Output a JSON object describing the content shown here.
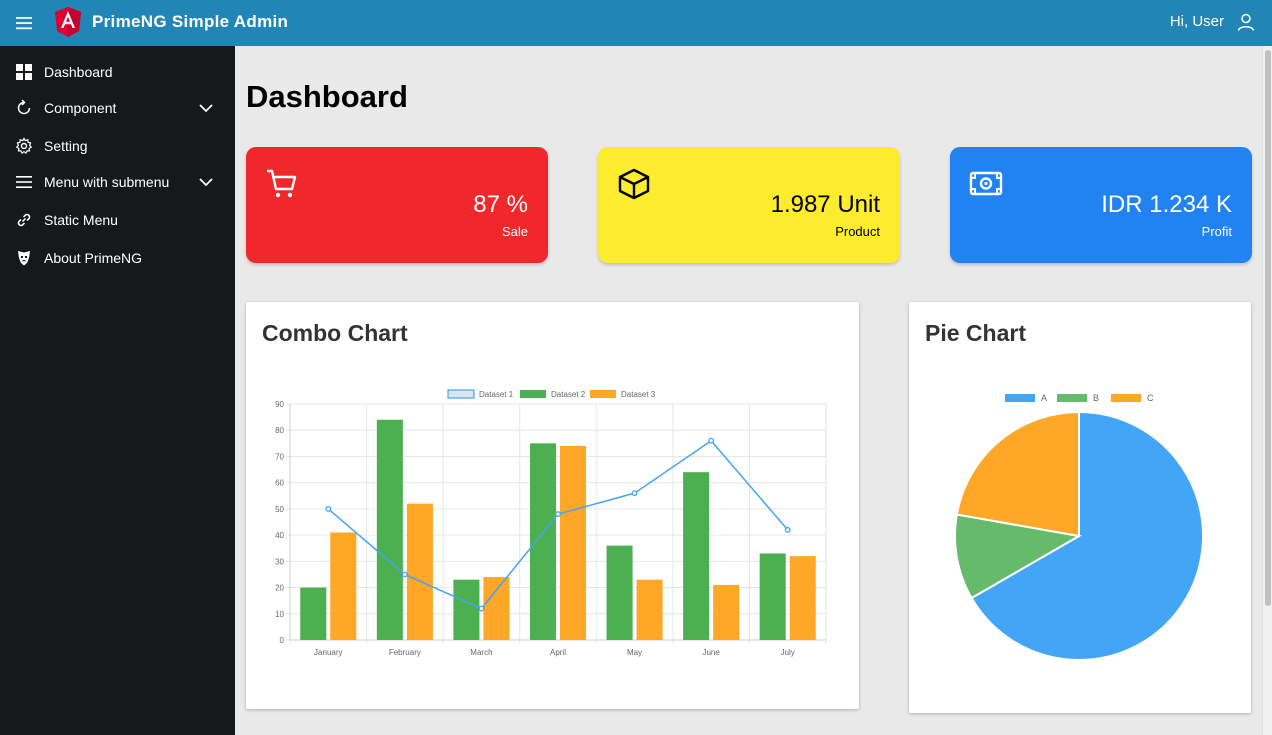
{
  "topbar": {
    "title": "PrimeNG Simple Admin",
    "greeting": "Hi, User",
    "logo_icon": "angular-logo-icon",
    "color": "#2185b5"
  },
  "sidebar": {
    "items": [
      {
        "label": "Dashboard",
        "icon": "grid-icon",
        "has_submenu": false
      },
      {
        "label": "Component",
        "icon": "refresh-icon",
        "has_submenu": true
      },
      {
        "label": "Setting",
        "icon": "gear-icon",
        "has_submenu": false
      },
      {
        "label": "Menu with submenu",
        "icon": "bars-icon",
        "has_submenu": true
      },
      {
        "label": "Static Menu",
        "icon": "link-icon",
        "has_submenu": false
      },
      {
        "label": "About PrimeNG",
        "icon": "prime-logo-icon",
        "has_submenu": false
      }
    ]
  },
  "page": {
    "title": "Dashboard"
  },
  "cards": [
    {
      "value": "87 %",
      "label": "Sale",
      "icon": "cart-icon",
      "color": "#f0282c",
      "text_color": "#ffffff"
    },
    {
      "value": "1.987 Unit",
      "label": "Product",
      "icon": "box-icon",
      "color": "#fdeb2d",
      "text_color": "#000000"
    },
    {
      "value": "IDR 1.234 K",
      "label": "Profit",
      "icon": "money-icon",
      "color": "#2182f2",
      "text_color": "#ffffff"
    }
  ],
  "combo": {
    "title": "Combo Chart"
  },
  "pie": {
    "title": "Pie Chart"
  },
  "chart_data": [
    {
      "type": "bar",
      "subtype": "combo (line + bar)",
      "categories": [
        "January",
        "February",
        "March",
        "April",
        "May",
        "June",
        "July"
      ],
      "series": [
        {
          "name": "Dataset 1",
          "type": "line",
          "color": "#42a5f5",
          "values": [
            50,
            25,
            12,
            48,
            56,
            76,
            42
          ]
        },
        {
          "name": "Dataset 2",
          "type": "bar",
          "color": "#4caf50",
          "values": [
            20,
            84,
            23,
            75,
            36,
            64,
            33
          ]
        },
        {
          "name": "Dataset 3",
          "type": "bar",
          "color": "#ffa726",
          "values": [
            41,
            52,
            24,
            74,
            23,
            21,
            32
          ]
        }
      ],
      "ylim": [
        0,
        90
      ],
      "yticks": [
        0,
        10,
        20,
        30,
        40,
        50,
        60,
        70,
        80,
        90
      ],
      "grid": true,
      "legend": "top"
    },
    {
      "type": "pie",
      "labels": [
        "A",
        "B",
        "C"
      ],
      "values": [
        300,
        50,
        100
      ],
      "colors": [
        "#42a5f5",
        "#66bb6a",
        "#ffa726"
      ],
      "legend": "top"
    }
  ]
}
